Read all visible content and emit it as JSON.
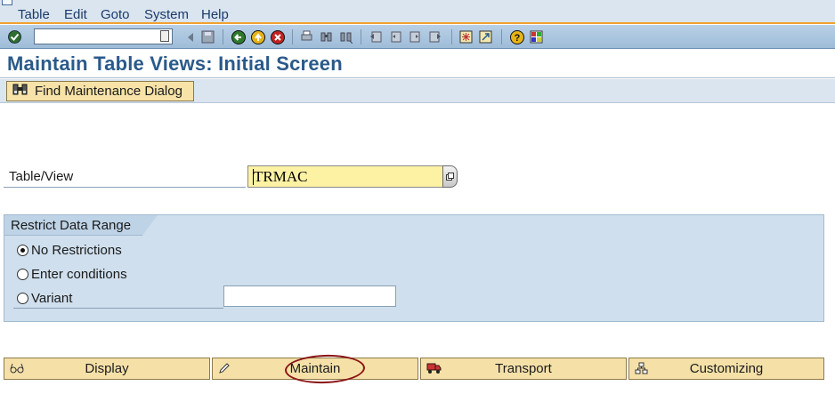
{
  "menu": [
    "Table",
    "Edit",
    "Goto",
    "System",
    "Help"
  ],
  "toolbar": {
    "command_value": ""
  },
  "title": "Maintain Table Views: Initial Screen",
  "app_toolbar": {
    "find_label": "Find Maintenance Dialog"
  },
  "table_view": {
    "label": "Table/View",
    "value": "TRMAC"
  },
  "restrict": {
    "title": "Restrict Data Range",
    "options": [
      "No Restrictions",
      "Enter conditions",
      "Variant"
    ],
    "selected": "No Restrictions",
    "variant_value": ""
  },
  "buttons": {
    "display": "Display",
    "maintain": "Maintain",
    "transport": "Transport",
    "customizing": "Customizing"
  },
  "colors": {
    "accent": "#f0a030",
    "title": "#2a5a8a",
    "button_fill": "#f5e1a8",
    "highlight_circle": "#8a1414"
  }
}
